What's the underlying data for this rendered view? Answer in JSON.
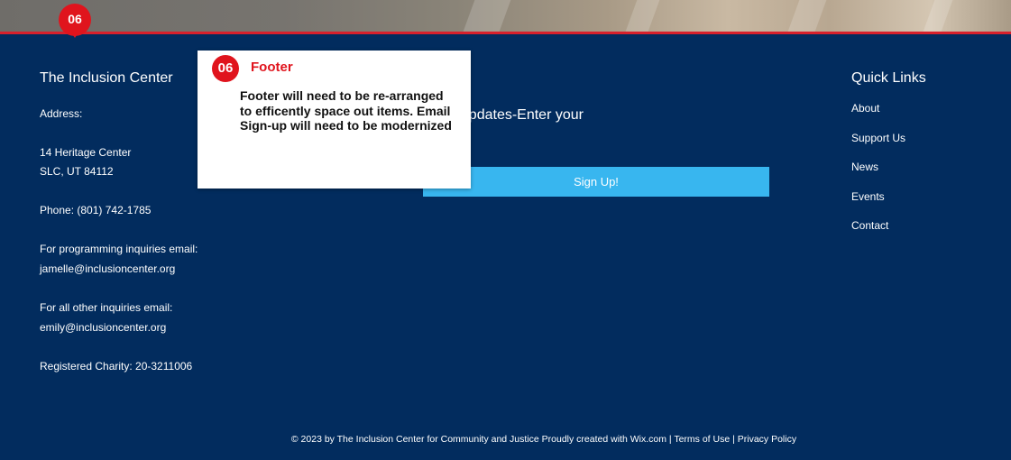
{
  "annotation_marker": {
    "number": "06"
  },
  "annotation": {
    "number": "06",
    "title": "Footer",
    "body": "Footer will need to be re-arranged to efficently space out items. Email Sign-up will need to be modernized"
  },
  "footer": {
    "site_title": "The Inclusion Center",
    "address_label": "Address:",
    "address_line1": "14 Heritage Center",
    "address_line2": "SLC, UT 84112",
    "phone": "Phone:  (801) 742-1785",
    "programming_label": "For programming inquiries email:",
    "programming_email": "jamelle@inclusioncenter.org",
    "other_label": "For all other inquiries email:",
    "other_email": "emily@inclusioncenter.org",
    "charity": "Registered Charity: 20-3211006"
  },
  "newsletter": {
    "prompt_visible": "nthly Updates-Enter your",
    "button_label": "Sign Up!"
  },
  "quick_links": {
    "title": "Quick Links",
    "items": [
      "About",
      "Support Us",
      "News",
      "Events",
      "Contact"
    ]
  },
  "bottom_bar": {
    "copyright": "© 2023 by The Inclusion Center for Community and Justice  Proudly created with Wix.com",
    "sep1": " | ",
    "terms": "Terms of Use",
    "sep2": " | ",
    "privacy": "Privacy Policy"
  },
  "colors": {
    "footer_bg": "#022c5e",
    "accent_red": "#e0141d",
    "button_blue": "#38b6ef"
  }
}
